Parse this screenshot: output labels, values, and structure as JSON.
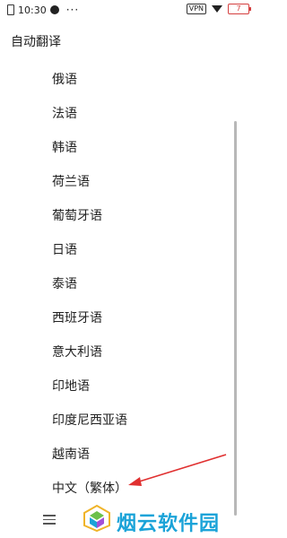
{
  "status_bar": {
    "time": "10:30",
    "menu_dots": "···",
    "vpn": "VPN",
    "battery": "7"
  },
  "title": "自动翻译",
  "languages": [
    {
      "label": "俄语"
    },
    {
      "label": "法语"
    },
    {
      "label": "韩语"
    },
    {
      "label": "荷兰语"
    },
    {
      "label": "葡萄牙语"
    },
    {
      "label": "日语"
    },
    {
      "label": "泰语"
    },
    {
      "label": "西班牙语"
    },
    {
      "label": "意大利语"
    },
    {
      "label": "印地语"
    },
    {
      "label": "印度尼西亚语"
    },
    {
      "label": "越南语"
    },
    {
      "label": "中文（繁体）"
    }
  ],
  "watermark": {
    "text": "烟云软件园"
  },
  "annotation": {
    "color": "#e03030"
  },
  "nav_menu_icon": "menu-icon"
}
